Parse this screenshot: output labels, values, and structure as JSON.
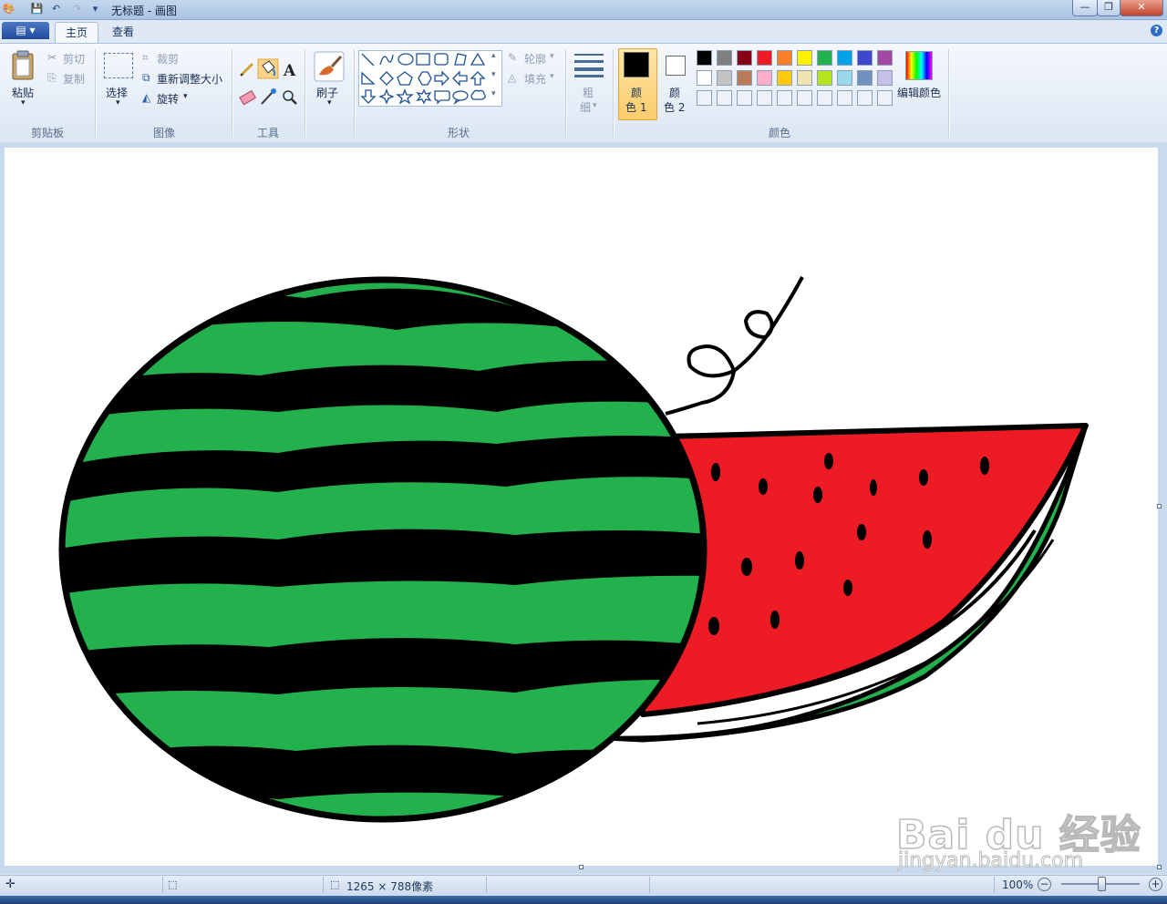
{
  "window": {
    "title": "无标题 - 画图",
    "minimize": "—",
    "maximize": "❐",
    "close": "✕"
  },
  "quick_access": {
    "save": "💾",
    "undo": "↶",
    "redo": "↷",
    "customize": "▾"
  },
  "tabs": {
    "app_menu": "▤ ▾",
    "home": "主页",
    "view": "查看",
    "help": "?"
  },
  "ribbon": {
    "clipboard": {
      "label": "剪贴板",
      "paste": "粘贴",
      "cut": "剪切",
      "copy": "复制"
    },
    "image": {
      "label": "图像",
      "select": "选择",
      "crop": "裁剪",
      "resize": "重新调整大小",
      "rotate": "旋转"
    },
    "tools": {
      "label": "工具"
    },
    "brushes": {
      "label": "刷子"
    },
    "shapes": {
      "label": "形状",
      "outline": "轮廓",
      "fill": "填充"
    },
    "size": {
      "label_line1": "粗",
      "label_line2": "细"
    },
    "colors": {
      "label": "颜色",
      "color1_line1": "颜",
      "color1_line2": "色 1",
      "color2_line1": "颜",
      "color2_line2": "色 2",
      "edit": "编辑颜色",
      "color1_value": "#000000",
      "color2_value": "#ffffff",
      "palette_row1": [
        "#000000",
        "#7f7f7f",
        "#880015",
        "#ed1c24",
        "#ff7f27",
        "#fff200",
        "#22b14c",
        "#00a2e8",
        "#3f48cc",
        "#a349a4"
      ],
      "palette_row2": [
        "#ffffff",
        "#c3c3c3",
        "#b97a57",
        "#ffaec9",
        "#ffc90e",
        "#efe4b0",
        "#b5e61d",
        "#99d9ea",
        "#7092be",
        "#c8bfe7"
      ]
    }
  },
  "statusbar": {
    "canvas_size": "1265 × 788像素",
    "zoom": "100%",
    "zoom_out": "−",
    "zoom_in": "+",
    "zoom_level": 1.0
  },
  "watermark": {
    "line1": "Bai du 经验",
    "line2": "jingyan.baidu.com"
  },
  "drawing": {
    "fill_colors": {
      "rind": "#22b14c",
      "flesh": "#ed1c24",
      "outline": "#000000"
    }
  }
}
